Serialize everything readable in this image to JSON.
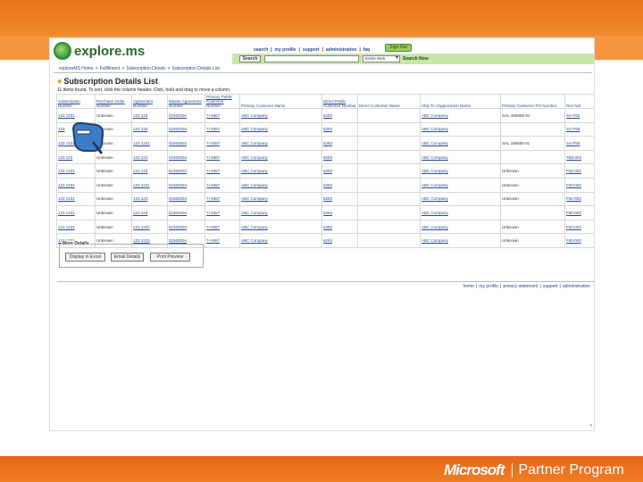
{
  "brand": {
    "logo": "Microsoft",
    "program": "Partner Program"
  },
  "site": {
    "name": "explore.ms",
    "top_links": [
      "search",
      "|",
      "my profile",
      "|",
      "support",
      "|",
      "administration",
      "|",
      "faq"
    ],
    "signout_label": "Sign Out",
    "search_label": "Search",
    "search_value": "",
    "search_scope": "Entire Web",
    "search_go": "Search Now"
  },
  "breadcrumb": [
    "exploreMS Home",
    ">",
    "Fulfillment",
    ">",
    "Subscription Details",
    ">",
    "Subscription Details List"
  ],
  "page": {
    "title": "Subscription Details List",
    "hint": "11 items found. To sort, click the column header. Click, hold and drag to move a column."
  },
  "table": {
    "columns": [
      "Subscription Number",
      "Purchase Order Number",
      "Agreement Number",
      "Master Agreement Number",
      "Primary Public Customer Number",
      "Primary Customer Name",
      "Direct Public Customer Number",
      "Direct Customer Name",
      "Ship To Organization Name",
      "Primary Customer PO Number",
      "Rev Net"
    ],
    "rows": [
      [
        "123 1231",
        "Unknown",
        "123 123",
        "01562004",
        "7+4657",
        "ABC Company",
        "6283",
        "",
        "ABC Company",
        "SAL-166080-01",
        "SA-F55"
      ],
      [
        "123",
        "Unknown",
        "123 123",
        "01562004",
        "7+4657",
        "ABC Company",
        "6283",
        "",
        "ABC Company",
        "",
        "SA-F55"
      ],
      [
        "123 1231",
        "Unknown",
        "123 1231",
        "01562004",
        "7+4657",
        "ABC Company",
        "6283",
        "",
        "ABC Company",
        "SAL 166080-01",
        "SA-F55"
      ],
      [
        "123 123",
        "Unknown",
        "123 123",
        "01562004",
        "7+4657",
        "ABC Company",
        "6283",
        "",
        "ABC Company",
        "",
        "7B5-003"
      ],
      [
        "123 1231",
        "Unknown",
        "123 123",
        "01562004",
        "7+4657",
        "ABC Company",
        "6283",
        "",
        "ABC Company",
        "Unknown",
        "F52-003"
      ],
      [
        "123 1231",
        "Unknown",
        "123 1231",
        "01562004",
        "7+4657",
        "ABC Company",
        "6283",
        "",
        "ABC Company",
        "Unknown",
        "F58-003"
      ],
      [
        "123 1231",
        "Unknown",
        "123 123",
        "01562004",
        "7+4657",
        "ABC Company",
        "6283",
        "",
        "ABC Company",
        "Unknown",
        "F62-003"
      ],
      [
        "123 1231",
        "Unknown",
        "123 123",
        "01562004",
        "7+4657",
        "ABC Company",
        "6283",
        "",
        "ABC Company",
        "",
        "F60-003"
      ],
      [
        "123 1231",
        "Unknown",
        "123 1231",
        "01562004",
        "7+4657",
        "ABC Company",
        "6283",
        "",
        "ABC Company",
        "Unknown",
        "F60-003"
      ],
      [
        "123 1231",
        "Unknown",
        "123 1231",
        "01562004",
        "7+4657",
        "ABC Company",
        "6283",
        "",
        "ABC Company",
        "Unknown",
        "F60-003"
      ]
    ]
  },
  "more_details": {
    "legend": "More Details",
    "buttons": [
      "Display in Excel",
      "Email Details",
      "Print Preview"
    ]
  },
  "footer_links": [
    "home",
    "|",
    "my profile",
    "|",
    "privacy statement",
    "|",
    "support",
    "|",
    "administration"
  ]
}
